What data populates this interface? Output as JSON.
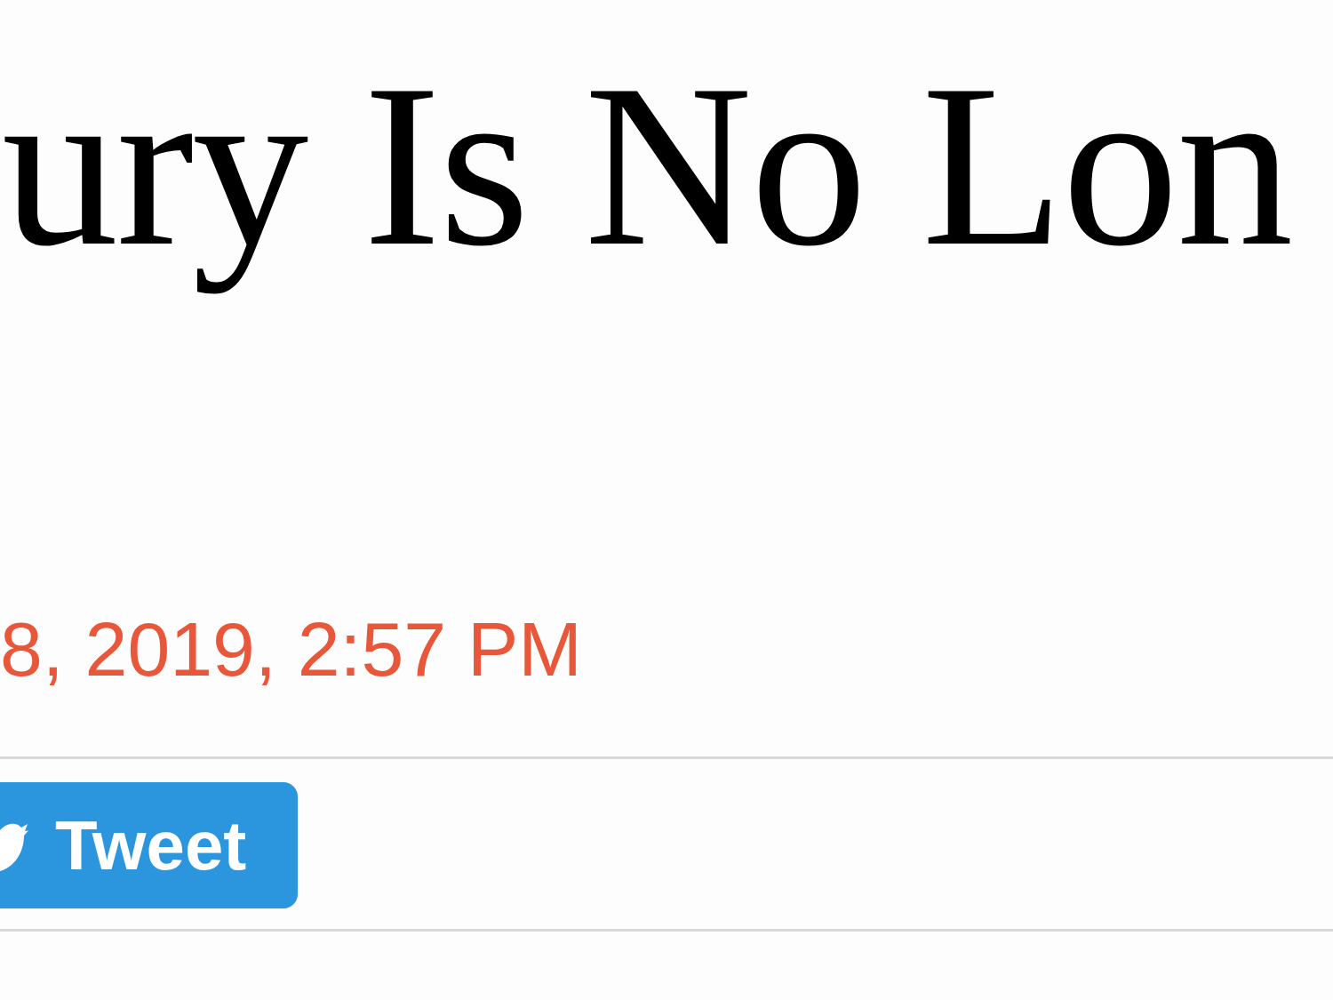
{
  "article": {
    "headline": "ury Is No Lon",
    "timestamp": "8, 2019, 2:57 PM"
  },
  "share_bar": {
    "buttons": [
      {
        "kind": "tweet",
        "label": "Tweet"
      }
    ]
  }
}
